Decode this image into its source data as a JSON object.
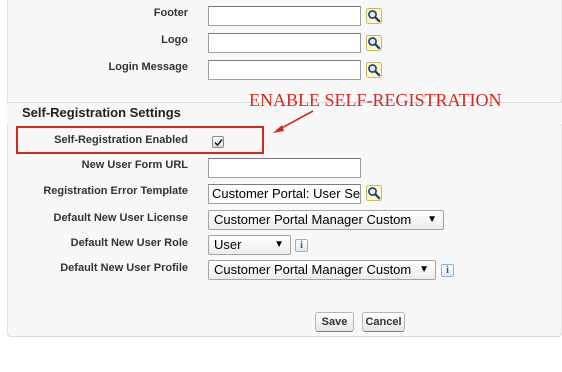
{
  "fields_top": [
    {
      "label": "Footer",
      "value": ""
    },
    {
      "label": "Logo",
      "value": ""
    },
    {
      "label": "Login Message",
      "value": ""
    }
  ],
  "section": {
    "title": "Self-Registration Settings"
  },
  "annotation": {
    "text": "ENABLE SELF-REGISTRATION",
    "color": "#d8271c"
  },
  "self_registration": {
    "enabled_label": "Self-Registration Enabled",
    "enabled": true,
    "form_url_label": "New User Form URL",
    "form_url_value": "",
    "error_template_label": "Registration Error Template",
    "error_template_value": "Customer Portal:  User Se",
    "license_label": "Default New User License",
    "license_value": "Customer Portal Manager Custom",
    "role_label": "Default New User Role",
    "role_value": "User",
    "profile_label": "Default New User Profile",
    "profile_value": "Customer Portal Manager Custom"
  },
  "buttons": {
    "save": "Save",
    "cancel": "Cancel"
  },
  "icons": {
    "lookup": "magnifier-lookup-icon",
    "info": "info-icon",
    "dropdown": "chevron-down-icon",
    "check": "checkmark-icon"
  }
}
